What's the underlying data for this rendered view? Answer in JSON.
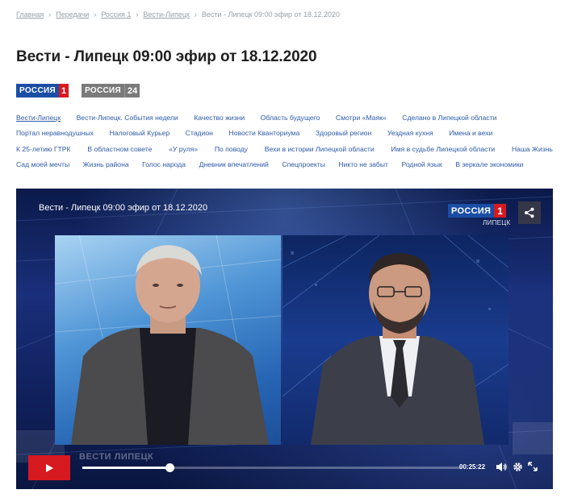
{
  "breadcrumb": {
    "items": [
      "Главная",
      "Передачи",
      "Россия 1",
      "Вести-Липецк"
    ],
    "current": "Вести - Липецк 09:00 эфир от 18.12.2020"
  },
  "page": {
    "title": "Вести - Липецк 09:00 эфир от 18.12.2020"
  },
  "channels": [
    {
      "name": "РОССИЯ",
      "number": "1"
    },
    {
      "name": "РОССИЯ",
      "number": "24"
    }
  ],
  "tags": [
    [
      "Вести-Липецк",
      "Вести-Липецк. События недели",
      "Качество жизни",
      "Область будущего",
      "Смотри «Маяк»",
      "Сделано в Липецкой области"
    ],
    [
      "Портал неравнодушных",
      "Налоговый Курьер",
      "Стадион",
      "Новости Кванториума",
      "Здоровый регион",
      "Уездная кухня",
      "Имена и вехи"
    ],
    [
      "К 25-летию ГТРК",
      "В областном совете",
      "«У руля»",
      "По поводу",
      "Вехи в истории Липецкой области",
      "Имя в судьбе Липецкой области",
      "Наша Жизнь"
    ],
    [
      "Сад моей мечты",
      "Жизнь района",
      "Голос народа",
      "Дневник впечатлений",
      "Спецпроекты",
      "Никто не забыт",
      "Родной язык",
      "В зеркале экономики"
    ]
  ],
  "active_tag": "Вести-Липецк",
  "player": {
    "title": "Вести - Липецк 09:00 эфир от 18.12.2020",
    "channel_name": "РОССИЯ",
    "channel_number": "1",
    "city": "ЛИПЕЦК",
    "lower_third": "ВЕСТИ  ЛИПЕЦК",
    "time": "00:25:22",
    "progress": 0.23
  },
  "colors": {
    "link": "#2d5aa8",
    "brand_blue": "#1a4ea6",
    "brand_red": "#d71920",
    "title": "#1f1f1f"
  },
  "icons": [
    "share-icon",
    "play-icon",
    "volume-icon",
    "settings-icon",
    "fullscreen-icon"
  ]
}
